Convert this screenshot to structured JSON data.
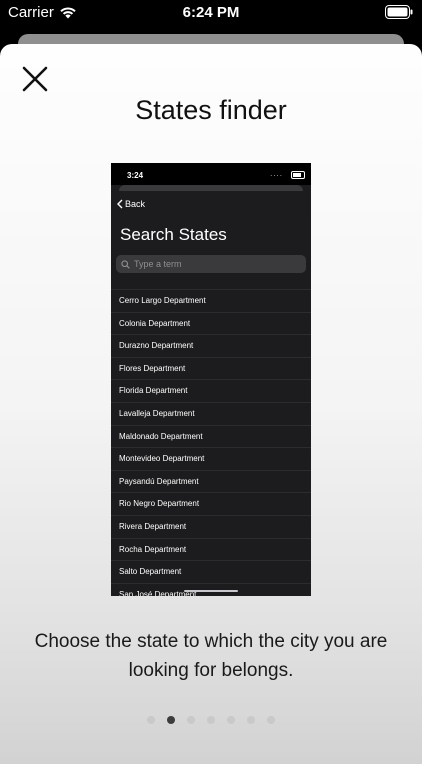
{
  "status_bar": {
    "carrier": "Carrier",
    "time": "6:24 PM"
  },
  "sheet": {
    "title": "States finder",
    "caption": "Choose the state to which the city you are looking for belongs."
  },
  "preview": {
    "time": "3:24",
    "signal_dots": "....",
    "back_label": "Back",
    "title": "Search States",
    "search_placeholder": "Type a term",
    "states": [
      "Cerro Largo Department",
      "Colonia Department",
      "Durazno Department",
      "Flores Department",
      "Florida Department",
      "Lavalleja Department",
      "Maldonado Department",
      "Montevideo Department",
      "Paysandú Department",
      "Rio Negro Department",
      "Rivera Department",
      "Rocha Department",
      "Salto Department",
      "San José Department"
    ]
  },
  "pagination": {
    "total_pages": 7,
    "current_index": 1
  },
  "colors": {
    "sheet_bg": "#f4f4f4",
    "preview_bg": "#1c1c1e",
    "active_dot": "#3c3c3c",
    "inactive_dot": "#c9c9c9"
  }
}
